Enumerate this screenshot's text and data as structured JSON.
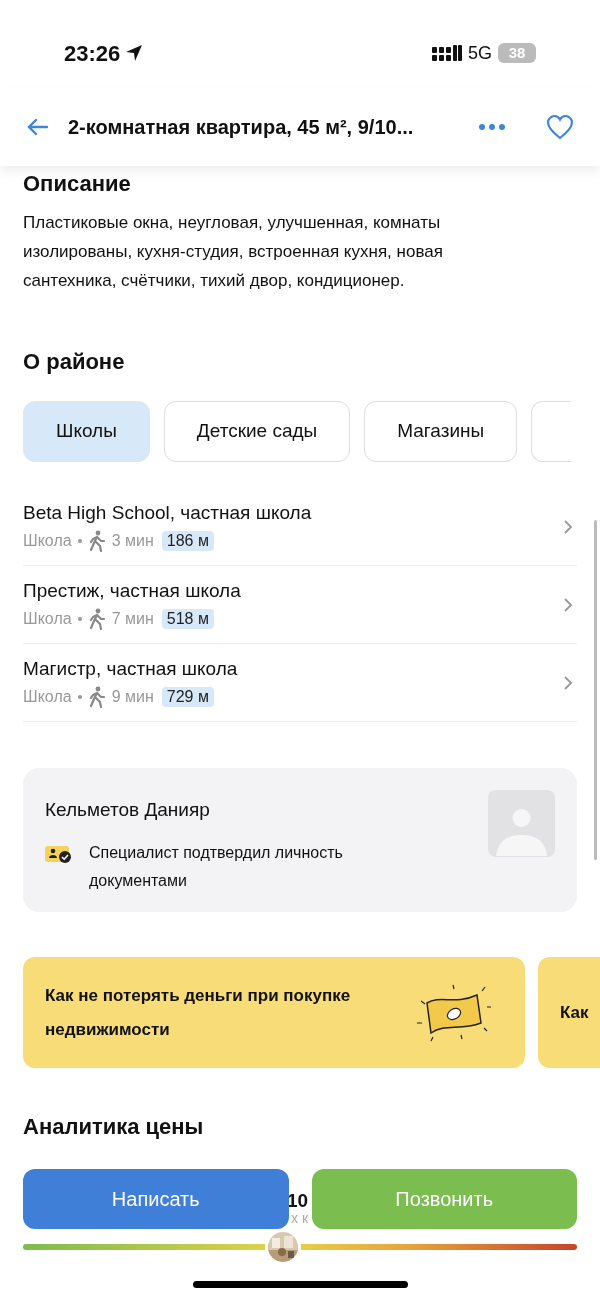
{
  "status_bar": {
    "time": "23:26",
    "network": "5G",
    "battery": "38"
  },
  "header": {
    "title": "2-комнатная квартира, 45 м², 9/10..."
  },
  "description": {
    "heading": "Описание",
    "text": "Пластиковые окна, неугловая, улучшенная, комнаты изолированы, кухня-студия, встроенная кухня, новая сантехника, счётчики, тихий двор, кондиционер."
  },
  "district": {
    "heading": "О районе",
    "tabs": [
      {
        "label": "Школы",
        "selected": true
      },
      {
        "label": "Детские сады",
        "selected": false
      },
      {
        "label": "Магазины",
        "selected": false
      }
    ],
    "places": [
      {
        "name": "Beta High School, частная школа",
        "type": "Школа",
        "walk": "3 мин",
        "distance": "186 м"
      },
      {
        "name": "Престиж, частная школа",
        "type": "Школа",
        "walk": "7 мин",
        "distance": "518 м"
      },
      {
        "name": "Магистр, частная школа",
        "type": "Школа",
        "walk": "9 мин",
        "distance": "729 м"
      }
    ]
  },
  "agent": {
    "name": "Кельметов Данияр",
    "verification": "Специалист подтвердил личность документами"
  },
  "articles": [
    {
      "title": "Как не потерять деньги при покупке недвижимости"
    },
    {
      "title": "Как"
    }
  ],
  "price_analytics": {
    "heading": "Аналитика цены",
    "value_fragment": "10",
    "label_fragment": "х к",
    "level": 0.47
  },
  "actions": [
    "Написать",
    "Позвонить"
  ]
}
